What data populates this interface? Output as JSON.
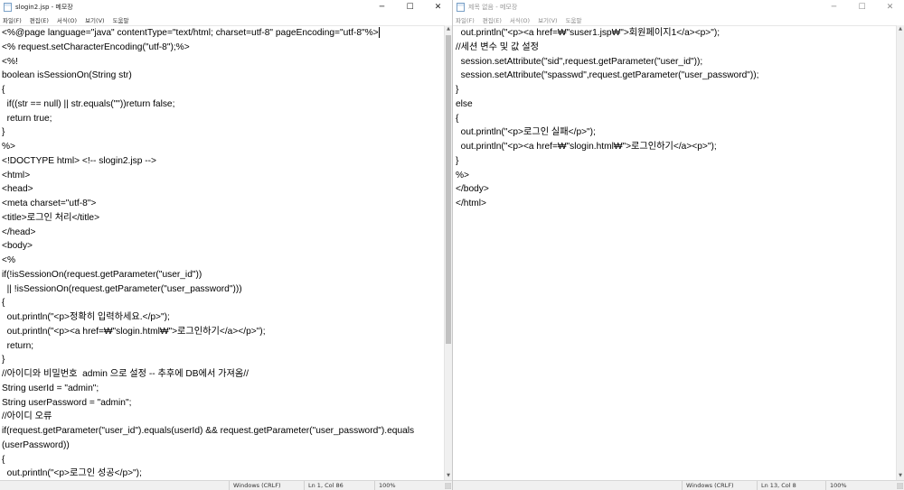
{
  "left": {
    "title": "slogin2.jsp - 메모장",
    "caption": {
      "minimize": "─",
      "maximize": "☐",
      "close": "✕"
    },
    "menu": [
      "파일(F)",
      "편집(E)",
      "서식(O)",
      "보기(V)",
      "도움말"
    ],
    "lines": [
      "<%@page language=\"java\" contentType=\"text/html; charset=utf-8\" pageEncoding=\"utf-8\"%>",
      "<% request.setCharacterEncoding(\"utf-8\");%>",
      "<%!",
      "boolean isSessionOn(String str)",
      "{",
      "  if((str == null) || str.equals(\"\"))return false;",
      "  return true;",
      "}",
      "%>",
      "<!DOCTYPE html> <!-- slogin2.jsp -->",
      "<html>",
      "<head>",
      "<meta charset=\"utf-8\">",
      "<title>로그인 처리</title>",
      "</head>",
      "<body>",
      "<%",
      "if(!isSessionOn(request.getParameter(\"user_id\"))",
      "  || !isSessionOn(request.getParameter(\"user_password\")))",
      "{",
      "  out.println(\"<p>정확히 입력하세요.</p>\");",
      "  out.println(\"<p><a href=₩\"slogin.html₩\">로그인하기</a></p>\");",
      "  return;",
      "}",
      "//아이디와 비밀번호  admin 으로 설정 -- 추후에 DB에서 가져옴//",
      "String userId = \"admin\";",
      "String userPassword = \"admin\";",
      "//아이디 오류",
      "if(request.getParameter(\"user_id\").equals(userId) && request.getParameter(\"user_password\").equals",
      "(userPassword))",
      "{",
      "  out.println(\"<p>로그인 성공</p>\");"
    ],
    "status": {
      "line_ending": "Windows (CRLF)",
      "position": "Ln 1, Col 86",
      "zoom": "100%"
    }
  },
  "right": {
    "title": "제목 없음 - 메모장",
    "caption": {
      "minimize": "─",
      "maximize": "☐",
      "close": "✕"
    },
    "menu": [
      "파일(F)",
      "편집(E)",
      "서식(O)",
      "보기(V)",
      "도움말"
    ],
    "lines": [
      "  out.println(\"<p><a href=₩\"suser1.jsp₩\">회원페이지1</a><p>\");",
      "//세션 변수 및 값 설정",
      "  session.setAttribute(\"sid\",request.getParameter(\"user_id\"));",
      "  session.setAttribute(\"spasswd\",request.getParameter(\"user_password\"));",
      "}",
      "else",
      "{",
      "  out.println(\"<p>로그인 실패</p>\");",
      "  out.println(\"<p><a href=₩\"slogin.html₩\">로그인하기</a><p>\");",
      "}",
      "%>",
      "</body>",
      "</html>"
    ],
    "status": {
      "line_ending": "Windows (CRLF)",
      "position": "Ln 13, Col 8",
      "zoom": "100%"
    }
  }
}
